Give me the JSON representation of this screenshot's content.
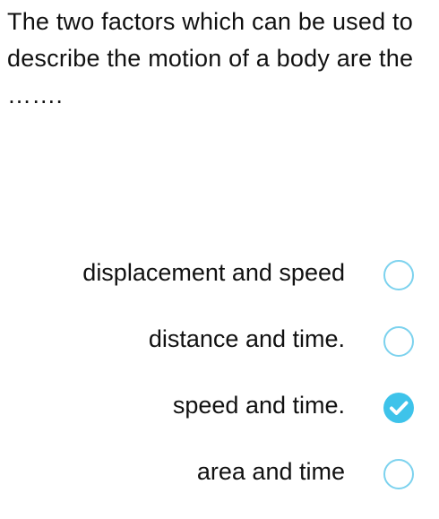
{
  "question": {
    "text": "The two factors which can be used to describe the motion of a body are the ……."
  },
  "options": [
    {
      "label": "displacement and speed",
      "selected": false
    },
    {
      "label": "distance and time.",
      "selected": false
    },
    {
      "label": "speed and time.",
      "selected": true
    },
    {
      "label": "area and time",
      "selected": false
    }
  ],
  "colors": {
    "accent": "#3ec3ea",
    "radio_border": "#7cd2ee",
    "text": "#111111",
    "background": "#ffffff"
  },
  "icons": {
    "unselected": "radio-empty-icon",
    "selected": "checkmark-circle-icon"
  }
}
